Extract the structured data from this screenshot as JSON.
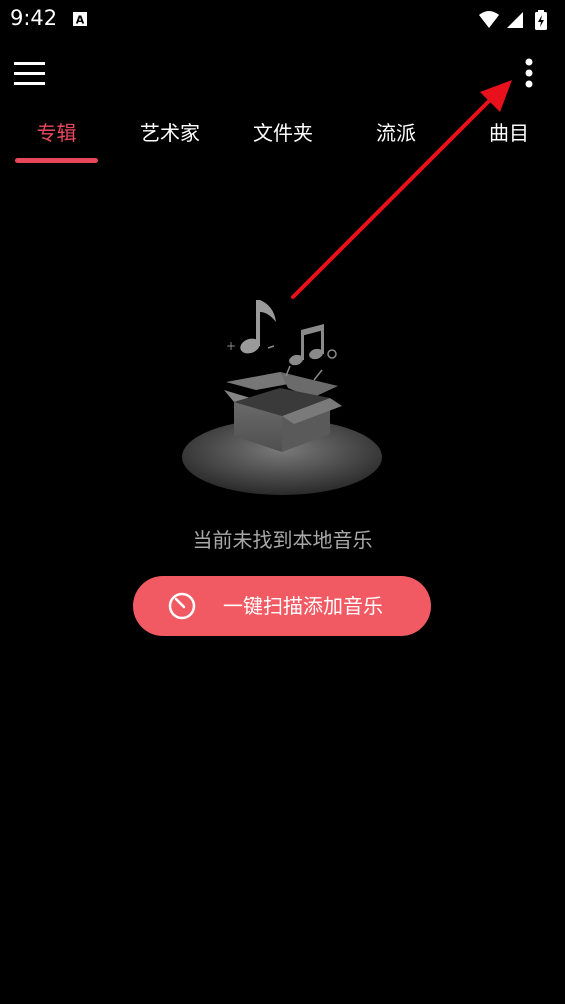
{
  "status_bar": {
    "time": "9:42",
    "icons": [
      "a-notification-icon",
      "wifi-icon",
      "signal-icon",
      "battery-charging-icon"
    ]
  },
  "toolbar": {
    "menu_icon": "hamburger-menu-icon",
    "more_icon": "more-vertical-icon"
  },
  "tabs": [
    {
      "label": "专辑",
      "active": true
    },
    {
      "label": "艺术家",
      "active": false
    },
    {
      "label": "文件夹",
      "active": false
    },
    {
      "label": "流派",
      "active": false
    },
    {
      "label": "曲目",
      "active": false
    }
  ],
  "empty_state": {
    "illustration": "music-box-illustration",
    "message": "当前未找到本地音乐",
    "scan_button_label": "一键扫描添加音乐",
    "scan_icon": "scan-clock-icon"
  },
  "colors": {
    "background": "#000000",
    "accent": "#e8485a",
    "button": "#f25a63",
    "muted_text": "#a8a8a8",
    "annotation_arrow": "#e8101a"
  }
}
